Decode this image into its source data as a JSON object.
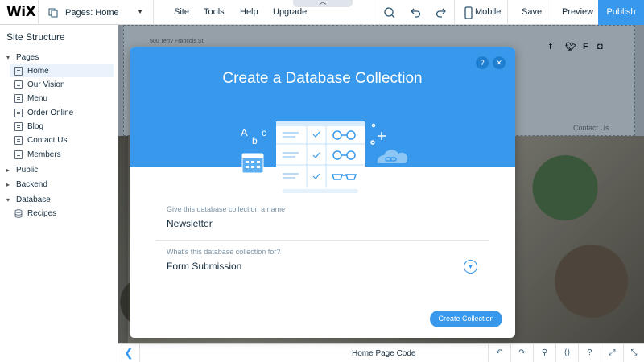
{
  "topbar": {
    "logo": "WiX",
    "pages_label": "Pages: Home",
    "nav": [
      "Site",
      "Tools",
      "Help",
      "Upgrade"
    ],
    "mobile_label": "Mobile",
    "save_label": "Save",
    "preview_label": "Preview",
    "publish_label": "Publish",
    "collapse_glyph": "︿"
  },
  "sidebar": {
    "title": "Site Structure",
    "pages_group": "Pages",
    "pages": [
      "Home",
      "Our Vision",
      "Menu",
      "Order Online",
      "Blog",
      "Contact Us",
      "Members"
    ],
    "public_label": "Public",
    "backend_label": "Backend",
    "database_label": "Database",
    "database_items": [
      "Recipes"
    ]
  },
  "site": {
    "address": "500 Terry Francois St.",
    "contact_link": "Contact Us",
    "social_icons": [
      "facebook-icon",
      "twitter-icon",
      "foursquare-icon",
      "instagram-icon"
    ]
  },
  "dialog": {
    "title": "Create a Database Collection",
    "help_glyph": "?",
    "close_glyph": "✕",
    "name_label": "Give this database collection a name",
    "name_value": "Newsletter",
    "purpose_label": "What's this database collection for?",
    "purpose_value": "Form Submission",
    "create_button": "Create Collection",
    "illustration_letters": [
      "A",
      "b",
      "c"
    ]
  },
  "bottombar": {
    "title": "Home Page Code",
    "back_glyph": "❮"
  },
  "colors": {
    "accent": "#3899ec",
    "text": "#162d3d"
  }
}
